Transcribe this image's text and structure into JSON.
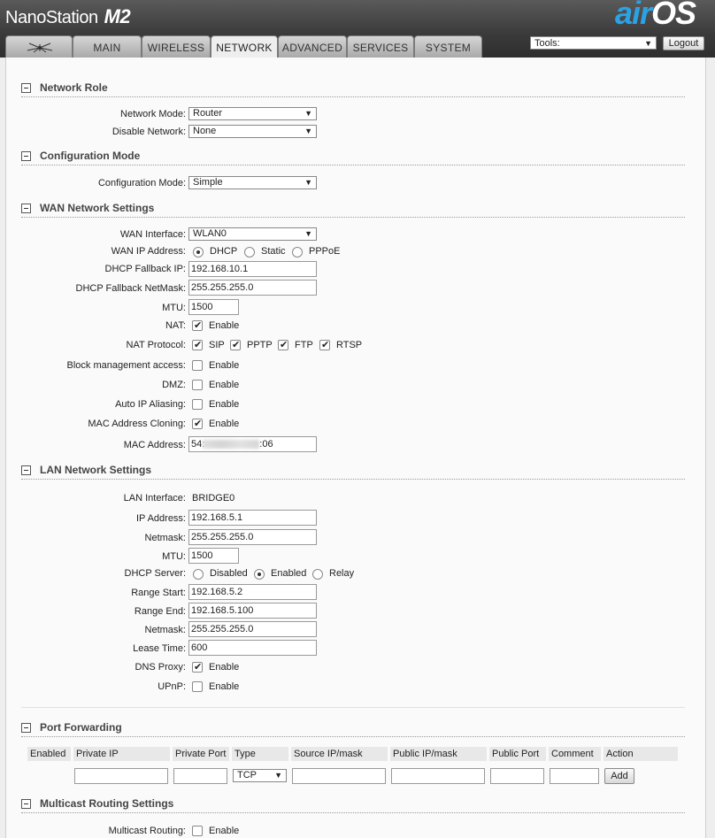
{
  "header": {
    "product": "NanoStation",
    "model": "M2",
    "brand_air": "air",
    "brand_os": "OS",
    "tabs": [
      "MAIN",
      "WIRELESS",
      "NETWORK",
      "ADVANCED",
      "SERVICES",
      "SYSTEM"
    ],
    "active_tab": "NETWORK",
    "tools_label": "Tools:",
    "logout": "Logout"
  },
  "network_role": {
    "title": "Network Role",
    "network_mode_label": "Network Mode:",
    "network_mode": "Router",
    "disable_network_label": "Disable Network:",
    "disable_network": "None"
  },
  "configuration_mode": {
    "title": "Configuration Mode",
    "label": "Configuration Mode:",
    "value": "Simple"
  },
  "wan": {
    "title": "WAN Network Settings",
    "interface_label": "WAN Interface:",
    "interface": "WLAN0",
    "ip_label": "WAN IP Address:",
    "ip_options": [
      "DHCP",
      "Static",
      "PPPoE"
    ],
    "ip_selected": "DHCP",
    "fallback_ip_label": "DHCP Fallback IP:",
    "fallback_ip": "192.168.10.1",
    "fallback_mask_label": "DHCP Fallback NetMask:",
    "fallback_mask": "255.255.255.0",
    "mtu_label": "MTU:",
    "mtu": "1500",
    "nat_label": "NAT:",
    "enable": "Enable",
    "nat_protocol_label": "NAT Protocol:",
    "nat_protocols": [
      "SIP",
      "PPTP",
      "FTP",
      "RTSP"
    ],
    "block_mgmt_label": "Block management access:",
    "dmz_label": "DMZ:",
    "auto_ip_label": "Auto IP Aliasing:",
    "mac_clone_label": "MAC Address Cloning:",
    "mac_label": "MAC Address:",
    "mac_prefix": "54:",
    "mac_suffix": ":06"
  },
  "lan": {
    "title": "LAN Network Settings",
    "interface_label": "LAN Interface:",
    "interface": "BRIDGE0",
    "ip_label": "IP Address:",
    "ip": "192.168.5.1",
    "netmask_label": "Netmask:",
    "netmask": "255.255.255.0",
    "mtu_label": "MTU:",
    "mtu": "1500",
    "dhcp_label": "DHCP Server:",
    "dhcp_options": [
      "Disabled",
      "Enabled",
      "Relay"
    ],
    "dhcp_selected": "Enabled",
    "range_start_label": "Range Start:",
    "range_start": "192.168.5.2",
    "range_end_label": "Range End:",
    "range_end": "192.168.5.100",
    "dhcp_netmask_label": "Netmask:",
    "dhcp_netmask": "255.255.255.0",
    "lease_label": "Lease Time:",
    "lease": "600",
    "dns_proxy_label": "DNS Proxy:",
    "upnp_label": "UPnP:",
    "enable": "Enable"
  },
  "port_forwarding": {
    "title": "Port Forwarding",
    "columns": [
      "Enabled",
      "Private IP",
      "Private Port",
      "Type",
      "Source IP/mask",
      "Public IP/mask",
      "Public Port",
      "Comment",
      "Action"
    ],
    "type_value": "TCP",
    "add": "Add"
  },
  "multicast": {
    "title": "Multicast Routing Settings",
    "label": "Multicast Routing:",
    "enable": "Enable"
  }
}
